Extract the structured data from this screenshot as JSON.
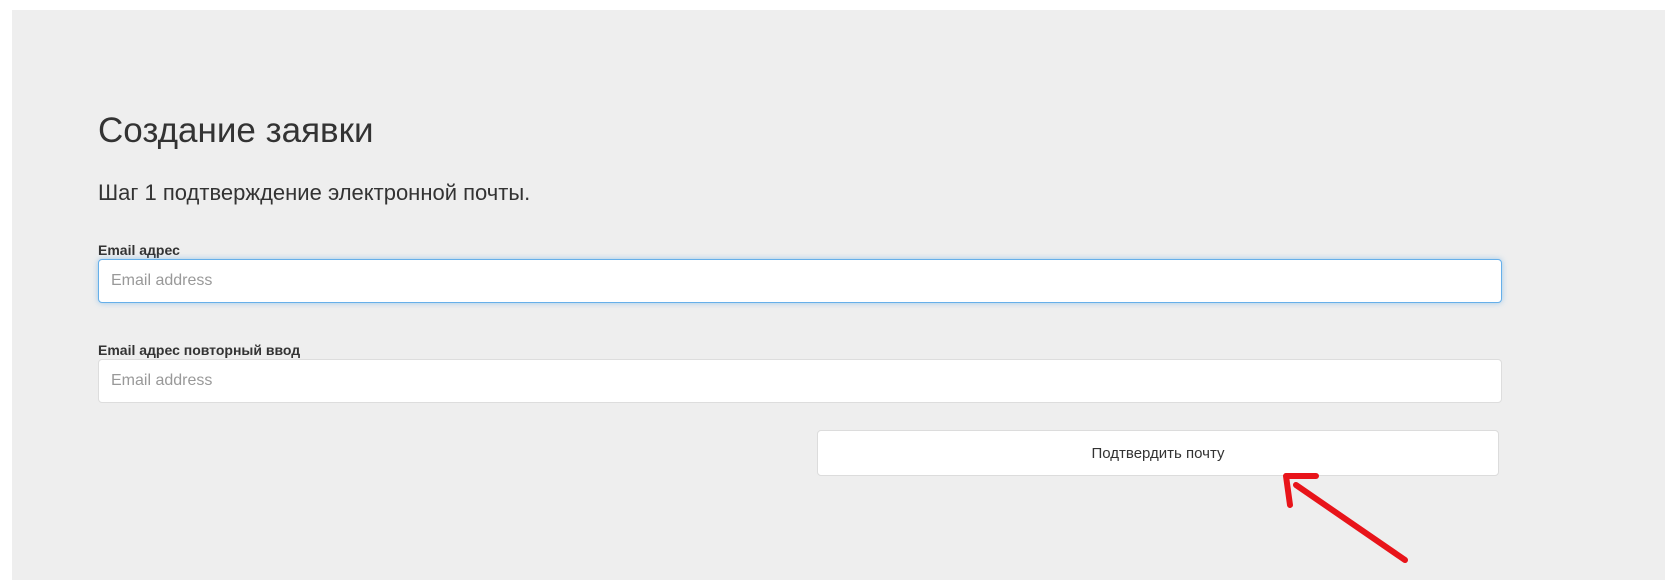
{
  "page_title": "Создание заявки",
  "step_text": "Шаг 1 подтверждение электронной почты.",
  "form": {
    "email": {
      "label": "Email адрес",
      "placeholder": "Email address",
      "value": ""
    },
    "email_repeat": {
      "label": "Email адрес повторный ввод",
      "placeholder": "Email address",
      "value": ""
    },
    "submit_label": "Подтвердить почту"
  },
  "colors": {
    "panel_background": "#eeeeee",
    "focus_border": "#66afe9",
    "annotation_arrow": "#e8141a"
  },
  "annotation": {
    "icon": "red-arrow-icon",
    "points_to": "confirm-button"
  }
}
